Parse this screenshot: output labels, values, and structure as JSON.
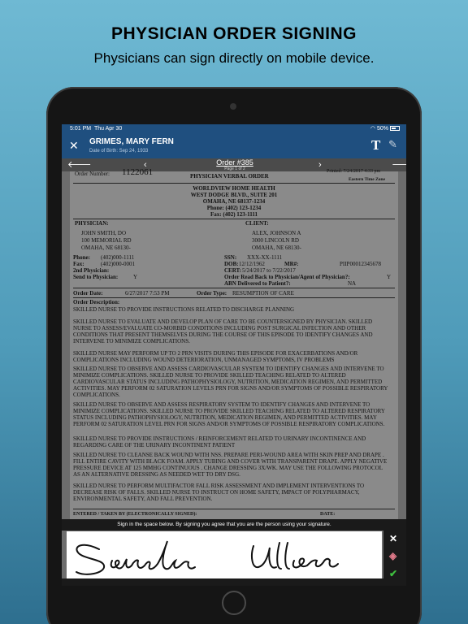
{
  "promo": {
    "title": "PHYSICIAN ORDER SIGNING",
    "subtitle": "Physicians can sign directly on mobile device."
  },
  "status": {
    "time": "5:01 PM",
    "date": "Thu Apr 30",
    "battery": "50%"
  },
  "header": {
    "patient_name": "GRIMES, MARY FERN",
    "dob": "Date of Birth: Sep 24, 1933"
  },
  "nav": {
    "order": "Order #385",
    "page": "Page 1 of 2"
  },
  "doc": {
    "top_left": "Order Number:",
    "order_no": "1122061",
    "doc_title": "PHYSICIAN VERBAL ORDER",
    "printed": "Printed: 7/24/2017 4:33 pm",
    "tz": "Eastern Time Zone",
    "agency": [
      "WORLDVIEW HOME HEALTH",
      "WEST DODGE BLVD., SUITE 201",
      "OMAHA, NE 68137-1234",
      "Phone: (402) 123-1234",
      "Fax: (402) 123-1111"
    ],
    "physician_label": "PHYSICIAN:",
    "client_label": "CLIENT:",
    "physician": [
      "JOHN SMITH, DO",
      "100 MEMORIAL RD",
      "OMAHA, NE 68130-"
    ],
    "client": [
      "ALEX, JOHNSON A",
      "3000 LINCOLN RD",
      "OMAHA, NE 68130-"
    ],
    "phone_l": "Phone:",
    "phone_v": "(402)000-1111",
    "fax_l": "Fax:",
    "fax_v": "(402)000-0001",
    "second": "2nd Physician:",
    "send_l": "Send to Physician:",
    "send_v": "Y",
    "ssn_l": "SSN:",
    "ssn_v": "XXX-XX-1111",
    "dob_l": "DOB:",
    "dob_v": "12/12/1962",
    "mr_l": "MR#:",
    "mr_v": "PIIP00012345678",
    "cert_l": "CERT:",
    "cert_v": "5/24/2017 to 7/22/2017",
    "readback": "Order Read Back to Physician/Agent of Physician?:",
    "readback_v": "Y",
    "abn": "ABN Delivered to Patient?:",
    "abn_v": "NA",
    "odate_l": "Order Date:",
    "odate_v": "6/27/2017 7:53 PM",
    "otype_l": "Order Type:",
    "otype_v": "RESUMPTION OF CARE",
    "desc_l": "Order Description:",
    "paras": [
      "SKILLED NURSE TO PROVIDE INSTRUCTIONS RELATED TO DISCHARGE PLANNING",
      "SKILLED NURSE TO EVALUATE AND DEVELOP PLAN OF CARE TO BE COUNTERSIGNED BY PHYSICIAN. SKILLED NURSE TO ASSESS/EVALUATE CO-MORBID CONDITIONS INCLUDING POST SURGICAL INFECTION AND OTHER CONDITIONS THAT PRESENT THEMSELVES DURING THE COURSE OF THIS EPISODE TO IDENTIFY CHANGES AND INTERVENE TO MINIMIZE COMPLICATIONS.",
      "SKILLED NURSE MAY PERFORM UP TO 2 PRN VISITS DURING THIS EPISODE FOR EXACERBATIONS AND/OR COMPLICATIONS INCLUDING WOUND DETERIORATION, UNMANAGED SYMPTOMS, IV PROBLEMS",
      "SKILLED NURSE TO OBSERVE AND ASSESS CARDIOVASCULAR SYSTEM TO IDENTIFY CHANGES AND INTERVENE TO MINIMIZE COMPLICATIONS. SKILLED NURSE TO PROVIDE SKILLED TEACHING RELATED TO ALTERED CARDIOVASCULAR STATUS INCLUDING PATHOPHYSIOLOGY, NUTRITION, MEDICATION  REGIMEN,  AND PERMITTED ACTIVITIES.   MAY PERFORM 02 SATURATION LEVELS PRN FOR SIGNS AND/OR SYMPTOMS OF POSSIBLE RESPIRATORY COMPLICATIONS.",
      "SKILLED NURSE TO OBSERVE AND ASSESS RESPIRATORY SYSTEM TO IDENTIFY CHANGES AND INTERVENE TO MINIMIZE COMPLICATIONS. SKILLED NURSE TO PROVIDE SKILLED TEACHING RELATED TO ALTERED RESPIRATORY STATUS INCLUDING PATHOPHYSIOLOGY, NUTRITION, MEDICATION REGIMEN, AND PERMITTED ACTIVITIES. MAY PERFORM 02 SATURATION LEVEL PRN FOR SIGNS AND/OR SYMPTOMS OF POSSIBLE RESPIRATORY COMPLICATIONS.",
      "SKILLED NURSE TO PROVIDE INSTRUCTIONS / REINFORCEMENT RELATED TO URINARY INCONTINENCE AND REGARDING CARE OF THE URINARY INCONTINENT PATIENT",
      "SKILLED NURSE TO CLEANSE BACK WOUND WITH NSS. PREPARE PERI-WOUND AREA WITH SKIN PREP AND DRAPE . FILL ENTIRE CAVITY WITH BLACK FOAM. APPLY TUBING AND COVER WITH TRANSPARENT DRAPE. APPLY NEGATIVE PRESSURE DEVICE AT 125 MMHG CONTINUOUS . CHANGE DRESSING 3X/WK. MAY USE THE FOLLOWING PROTOCOL AS AN ALTERNATIVE DRESSING AS NEEDED WET TO DRY DSG.",
      "SKILLED NURSE TO PERFORM MULTIFACTOR FALL RISK ASSESSMENT AND IMPLEMENT INTERVENTIONS TO DECREASE RISK OF FALLS. SKILLED NURSE TO INSTRUCT ON HOME SAFETY, IMPACT OF POLYPHARMACY, ENVIRONMENTAL SAFETY, AND FALL PREVENTION."
    ],
    "entered": "ENTERED / TAKEN BY (ELECTRONICALLY SIGNED):",
    "date_l": "DATE:"
  },
  "sign": {
    "instruction": "Sign in the space below. By signing you agree that you are the person using your signature."
  },
  "colors": {
    "header": "#1f4f7f",
    "accept": "#3fbf3f",
    "erase": "#e07a8a"
  }
}
